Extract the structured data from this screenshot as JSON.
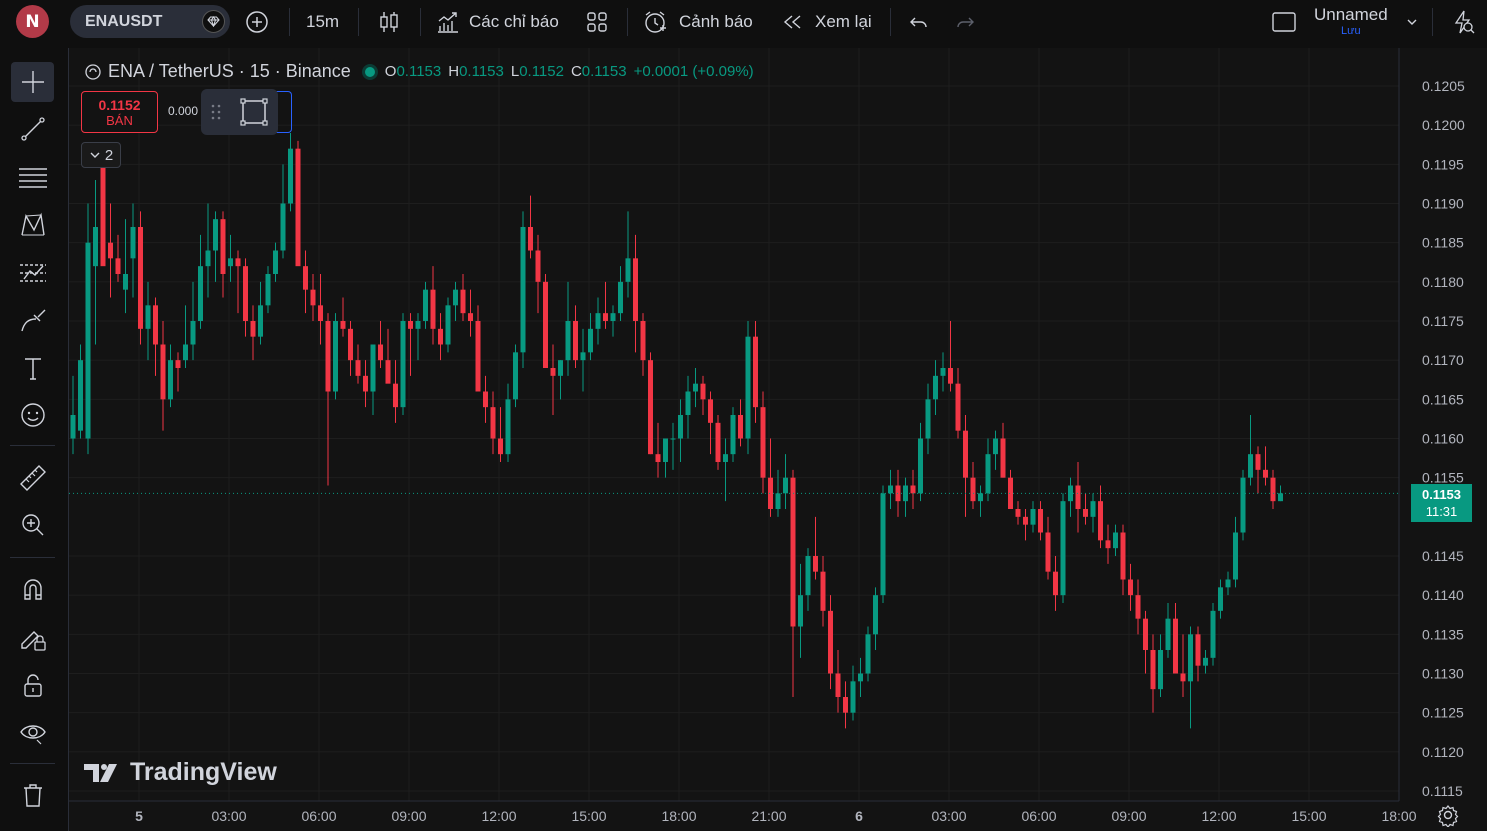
{
  "topbar": {
    "avatar_letter": "N",
    "symbol": "ENAUSDT",
    "interval": "15m",
    "indicators_label": "Các chỉ báo",
    "alerts_label": "Cảnh báo",
    "replay_label": "Xem lại",
    "layout_name": "Unnamed",
    "save_label": "Lưu"
  },
  "legend": {
    "title": "ENA / TetherUS · 15 · Binance",
    "o_label": "O",
    "o_value": "0.1153",
    "h_label": "H",
    "h_value": "0.1153",
    "l_label": "L",
    "l_value": "0.1152",
    "c_label": "C",
    "c_value": "0.1153",
    "change": "+0.0001 (+0.09%)"
  },
  "trade": {
    "sell_price": "0.1152",
    "sell_label": "BÁN",
    "spread": "0.000"
  },
  "collapse": {
    "count": "2"
  },
  "last_price": {
    "value": "0.1153",
    "countdown": "11:31"
  },
  "branding": {
    "logo_text": "TradingView"
  },
  "colors": {
    "up": "#089981",
    "down": "#f23645",
    "accent": "#2962ff",
    "background": "#131313"
  },
  "left_tools": [
    "crosshair-icon",
    "trendline-icon",
    "fib-lines-icon",
    "pattern-icon",
    "forecast-icon",
    "brush-icon",
    "text-icon",
    "emoji-icon",
    "ruler-icon",
    "zoom-in-icon",
    "magnet-icon",
    "lock-drawing-icon",
    "lock-icon",
    "eye-icon",
    "trash-icon"
  ],
  "chart_data": {
    "type": "candlestick",
    "symbol": "ENA / TetherUS",
    "interval": "15",
    "exchange": "Binance",
    "y_ticks": [
      "0.1205",
      "0.1200",
      "0.1195",
      "0.1190",
      "0.1185",
      "0.1180",
      "0.1175",
      "0.1170",
      "0.1165",
      "0.1160",
      "0.1155",
      "0.1145",
      "0.1140",
      "0.1135",
      "0.1130",
      "0.1125",
      "0.1120",
      "0.1115"
    ],
    "x_ticks": [
      "5",
      "03:00",
      "06:00",
      "09:00",
      "12:00",
      "15:00",
      "18:00",
      "21:00",
      "6",
      "03:00",
      "06:00",
      "09:00",
      "12:00",
      "15:00",
      "18:00"
    ],
    "ylim": [
      0.1114,
      0.12075
    ],
    "last_price": 0.1153,
    "series": [
      {
        "name": "ENAUSDT",
        "candles": [
          [
            0.116,
            0.1168,
            0.1158,
            0.1163
          ],
          [
            0.1161,
            0.1172,
            0.116,
            0.117
          ],
          [
            0.116,
            0.119,
            0.1158,
            0.1185
          ],
          [
            0.1182,
            0.1193,
            0.1172,
            0.1187
          ],
          [
            0.1195,
            0.1197,
            0.1185,
            0.1182
          ],
          [
            0.1185,
            0.119,
            0.1178,
            0.1183
          ],
          [
            0.1183,
            0.1186,
            0.118,
            0.1181
          ],
          [
            0.1179,
            0.1188,
            0.1176,
            0.1181
          ],
          [
            0.1183,
            0.119,
            0.1178,
            0.1187
          ],
          [
            0.1187,
            0.1189,
            0.1172,
            0.1174
          ],
          [
            0.1174,
            0.118,
            0.117,
            0.1177
          ],
          [
            0.1177,
            0.1178,
            0.1168,
            0.1172
          ],
          [
            0.1172,
            0.1175,
            0.1161,
            0.1165
          ],
          [
            0.1165,
            0.1172,
            0.1164,
            0.117
          ],
          [
            0.117,
            0.1171,
            0.1166,
            0.1169
          ],
          [
            0.117,
            0.1177,
            0.1169,
            0.1172
          ],
          [
            0.1172,
            0.118,
            0.117,
            0.1175
          ],
          [
            0.1175,
            0.1186,
            0.1174,
            0.1182
          ],
          [
            0.1182,
            0.119,
            0.1178,
            0.1184
          ],
          [
            0.1184,
            0.1189,
            0.118,
            0.1188
          ],
          [
            0.1188,
            0.1189,
            0.1178,
            0.1181
          ],
          [
            0.1182,
            0.1186,
            0.118,
            0.1183
          ],
          [
            0.1183,
            0.1184,
            0.1176,
            0.1182
          ],
          [
            0.1182,
            0.1183,
            0.1173,
            0.1175
          ],
          [
            0.1175,
            0.1177,
            0.117,
            0.1173
          ],
          [
            0.1173,
            0.118,
            0.1172,
            0.1177
          ],
          [
            0.1177,
            0.1182,
            0.1176,
            0.1181
          ],
          [
            0.1181,
            0.1185,
            0.118,
            0.1184
          ],
          [
            0.1184,
            0.1195,
            0.1183,
            0.119
          ],
          [
            0.119,
            0.1199,
            0.1189,
            0.1197
          ],
          [
            0.1197,
            0.1198,
            0.1183,
            0.1182
          ],
          [
            0.1182,
            0.1184,
            0.1176,
            0.1179
          ],
          [
            0.1179,
            0.1181,
            0.1175,
            0.1177
          ],
          [
            0.1177,
            0.1181,
            0.1172,
            0.1175
          ],
          [
            0.1175,
            0.1176,
            0.1154,
            0.1166
          ],
          [
            0.1166,
            0.1176,
            0.1165,
            0.1175
          ],
          [
            0.1175,
            0.1178,
            0.1173,
            0.1174
          ],
          [
            0.1174,
            0.1175,
            0.1168,
            0.117
          ],
          [
            0.117,
            0.1172,
            0.1167,
            0.1168
          ],
          [
            0.1168,
            0.117,
            0.1164,
            0.1166
          ],
          [
            0.1166,
            0.117,
            0.1163,
            0.1172
          ],
          [
            0.1172,
            0.1175,
            0.1169,
            0.117
          ],
          [
            0.117,
            0.1174,
            0.1168,
            0.1167
          ],
          [
            0.1167,
            0.117,
            0.1162,
            0.1164
          ],
          [
            0.1164,
            0.1176,
            0.1163,
            0.1175
          ],
          [
            0.1175,
            0.1176,
            0.1168,
            0.1174
          ],
          [
            0.1174,
            0.1176,
            0.117,
            0.1175
          ],
          [
            0.1175,
            0.118,
            0.1174,
            0.1179
          ],
          [
            0.1179,
            0.1182,
            0.1172,
            0.1174
          ],
          [
            0.1174,
            0.1176,
            0.117,
            0.1172
          ],
          [
            0.1172,
            0.1178,
            0.1171,
            0.1177
          ],
          [
            0.1177,
            0.118,
            0.1175,
            0.1179
          ],
          [
            0.1179,
            0.1181,
            0.1175,
            0.1176
          ],
          [
            0.1176,
            0.1179,
            0.1173,
            0.1175
          ],
          [
            0.1175,
            0.1177,
            0.1166,
            0.1166
          ],
          [
            0.1166,
            0.1168,
            0.1162,
            0.1164
          ],
          [
            0.1164,
            0.1166,
            0.1158,
            0.116
          ],
          [
            0.116,
            0.1164,
            0.1157,
            0.1158
          ],
          [
            0.1158,
            0.1167,
            0.1157,
            0.1165
          ],
          [
            0.1165,
            0.1172,
            0.1164,
            0.1171
          ],
          [
            0.1171,
            0.1189,
            0.1169,
            0.1187
          ],
          [
            0.1187,
            0.1191,
            0.1183,
            0.1184
          ],
          [
            0.1184,
            0.1186,
            0.1176,
            0.118
          ],
          [
            0.118,
            0.1181,
            0.117,
            0.1169
          ],
          [
            0.1169,
            0.1172,
            0.1163,
            0.1168
          ],
          [
            0.1168,
            0.117,
            0.1165,
            0.117
          ],
          [
            0.117,
            0.118,
            0.1168,
            0.1175
          ],
          [
            0.1175,
            0.1177,
            0.1169,
            0.117
          ],
          [
            0.117,
            0.1174,
            0.1166,
            0.1171
          ],
          [
            0.1171,
            0.1176,
            0.117,
            0.1174
          ],
          [
            0.1174,
            0.1178,
            0.1172,
            0.1176
          ],
          [
            0.1176,
            0.118,
            0.1174,
            0.1175
          ],
          [
            0.1175,
            0.1177,
            0.1173,
            0.1176
          ],
          [
            0.1176,
            0.1182,
            0.1175,
            0.118
          ],
          [
            0.118,
            0.1189,
            0.1178,
            0.1183
          ],
          [
            0.1183,
            0.1186,
            0.1171,
            0.1175
          ],
          [
            0.1175,
            0.1176,
            0.1168,
            0.117
          ],
          [
            0.117,
            0.1171,
            0.1158,
            0.1158
          ],
          [
            0.1158,
            0.1162,
            0.1155,
            0.1157
          ],
          [
            0.1157,
            0.116,
            0.1155,
            0.116
          ],
          [
            0.116,
            0.1162,
            0.1156,
            0.116
          ],
          [
            0.116,
            0.1165,
            0.1157,
            0.1163
          ],
          [
            0.1163,
            0.1168,
            0.116,
            0.1166
          ],
          [
            0.1166,
            0.1169,
            0.1164,
            0.1167
          ],
          [
            0.1167,
            0.1168,
            0.1163,
            0.1165
          ],
          [
            0.1165,
            0.1166,
            0.1158,
            0.1162
          ],
          [
            0.1162,
            0.1163,
            0.1156,
            0.1157
          ],
          [
            0.1157,
            0.116,
            0.1152,
            0.1158
          ],
          [
            0.1158,
            0.1164,
            0.1157,
            0.1163
          ],
          [
            0.1163,
            0.1165,
            0.1159,
            0.116
          ],
          [
            0.116,
            0.1175,
            0.1158,
            0.1173
          ],
          [
            0.1173,
            0.1175,
            0.1162,
            0.1164
          ],
          [
            0.1164,
            0.1166,
            0.1153,
            0.1155
          ],
          [
            0.1155,
            0.116,
            0.115,
            0.1151
          ],
          [
            0.1151,
            0.1156,
            0.115,
            0.1153
          ],
          [
            0.1153,
            0.1158,
            0.1151,
            0.1155
          ],
          [
            0.1155,
            0.1156,
            0.1127,
            0.1136
          ],
          [
            0.1136,
            0.1144,
            0.1132,
            0.114
          ],
          [
            0.114,
            0.1146,
            0.1138,
            0.1145
          ],
          [
            0.1145,
            0.115,
            0.1142,
            0.1143
          ],
          [
            0.1143,
            0.1145,
            0.1136,
            0.1138
          ],
          [
            0.1138,
            0.114,
            0.1128,
            0.113
          ],
          [
            0.113,
            0.1133,
            0.1125,
            0.1127
          ],
          [
            0.1127,
            0.1129,
            0.1123,
            0.1125
          ],
          [
            0.1125,
            0.1131,
            0.1124,
            0.1129
          ],
          [
            0.1129,
            0.1132,
            0.1127,
            0.113
          ],
          [
            0.113,
            0.1136,
            0.1129,
            0.1135
          ],
          [
            0.1135,
            0.1141,
            0.1133,
            0.114
          ],
          [
            0.114,
            0.1154,
            0.1139,
            0.1153
          ],
          [
            0.1153,
            0.1156,
            0.1151,
            0.1154
          ],
          [
            0.1154,
            0.1156,
            0.115,
            0.1152
          ],
          [
            0.1152,
            0.1155,
            0.115,
            0.1154
          ],
          [
            0.1154,
            0.1156,
            0.1151,
            0.1153
          ],
          [
            0.1153,
            0.1162,
            0.1152,
            0.116
          ],
          [
            0.116,
            0.1167,
            0.1158,
            0.1165
          ],
          [
            0.1165,
            0.117,
            0.1163,
            0.1168
          ],
          [
            0.1168,
            0.1171,
            0.1166,
            0.1169
          ],
          [
            0.1169,
            0.1175,
            0.1166,
            0.1167
          ],
          [
            0.1167,
            0.1169,
            0.116,
            0.1161
          ],
          [
            0.1161,
            0.1163,
            0.115,
            0.1155
          ],
          [
            0.1155,
            0.1157,
            0.1151,
            0.1152
          ],
          [
            0.1152,
            0.1154,
            0.115,
            0.1153
          ],
          [
            0.1153,
            0.116,
            0.1152,
            0.1158
          ],
          [
            0.1158,
            0.1161,
            0.1156,
            0.116
          ],
          [
            0.116,
            0.1162,
            0.1155,
            0.1155
          ],
          [
            0.1155,
            0.1156,
            0.1151,
            0.1151
          ],
          [
            0.1151,
            0.1152,
            0.1149,
            0.115
          ],
          [
            0.115,
            0.1151,
            0.1147,
            0.1149
          ],
          [
            0.1149,
            0.1152,
            0.1148,
            0.1151
          ],
          [
            0.1151,
            0.1152,
            0.1147,
            0.1148
          ],
          [
            0.1148,
            0.115,
            0.1142,
            0.1143
          ],
          [
            0.1143,
            0.1145,
            0.1138,
            0.114
          ],
          [
            0.114,
            0.1153,
            0.1139,
            0.1152
          ],
          [
            0.1152,
            0.1155,
            0.115,
            0.1154
          ],
          [
            0.1154,
            0.1157,
            0.1148,
            0.1151
          ],
          [
            0.1151,
            0.1153,
            0.1149,
            0.115
          ],
          [
            0.115,
            0.1153,
            0.1148,
            0.1152
          ],
          [
            0.1152,
            0.1154,
            0.1146,
            0.1147
          ],
          [
            0.1147,
            0.1149,
            0.1144,
            0.1146
          ],
          [
            0.1146,
            0.1149,
            0.1145,
            0.1148
          ],
          [
            0.1148,
            0.1149,
            0.114,
            0.1142
          ],
          [
            0.1142,
            0.1144,
            0.1138,
            0.114
          ],
          [
            0.114,
            0.1142,
            0.1135,
            0.1137
          ],
          [
            0.1137,
            0.1138,
            0.113,
            0.1133
          ],
          [
            0.1133,
            0.1135,
            0.1125,
            0.1128
          ],
          [
            0.1128,
            0.1135,
            0.1127,
            0.1133
          ],
          [
            0.1133,
            0.1139,
            0.1132,
            0.1137
          ],
          [
            0.1137,
            0.1139,
            0.113,
            0.113
          ],
          [
            0.113,
            0.1135,
            0.1127,
            0.1129
          ],
          [
            0.1129,
            0.1136,
            0.1123,
            0.1135
          ],
          [
            0.1135,
            0.1136,
            0.1129,
            0.1131
          ],
          [
            0.1131,
            0.1133,
            0.113,
            0.1132
          ],
          [
            0.1132,
            0.1139,
            0.1131,
            0.1138
          ],
          [
            0.1138,
            0.1142,
            0.1137,
            0.1141
          ],
          [
            0.1141,
            0.1143,
            0.114,
            0.1142
          ],
          [
            0.1142,
            0.115,
            0.1141,
            0.1148
          ],
          [
            0.1148,
            0.1156,
            0.1147,
            0.1155
          ],
          [
            0.1155,
            0.1163,
            0.1154,
            0.1158
          ],
          [
            0.1158,
            0.1159,
            0.1153,
            0.1156
          ],
          [
            0.1156,
            0.1159,
            0.1154,
            0.1155
          ],
          [
            0.1155,
            0.1156,
            0.1151,
            0.1152
          ],
          [
            0.1152,
            0.1154,
            0.1152,
            0.1153
          ]
        ]
      }
    ]
  }
}
